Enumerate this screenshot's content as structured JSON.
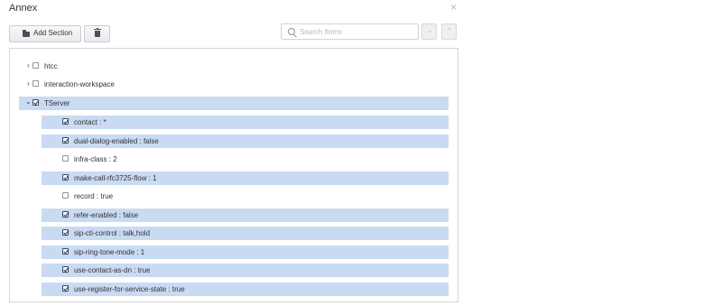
{
  "dialog": {
    "title": "Annex",
    "close_glyph": "×"
  },
  "toolbar": {
    "add_section_label": "Add Section",
    "add_icon": "folder-icon",
    "delete_icon": "trash-icon"
  },
  "search": {
    "placeholder": "Search Items",
    "value": "",
    "icon": "search-icon",
    "prev_glyph": "⌄",
    "next_glyph": "⌃"
  },
  "colors": {
    "selected_row": "#c9daf3",
    "panel_border": "#d4d7da"
  },
  "tree": {
    "sections": [
      {
        "label": "htcc",
        "checked": false,
        "expanded": false,
        "chevron": "›"
      },
      {
        "label": "interaction-workspace",
        "checked": false,
        "expanded": false,
        "chevron": "›"
      },
      {
        "label": "TServer",
        "checked": true,
        "expanded": true,
        "chevron": "⌄"
      }
    ],
    "items": [
      {
        "label": "contact : *",
        "checked": true
      },
      {
        "label": "dual-dialog-enabled : false",
        "checked": true
      },
      {
        "label": "infra-class : 2",
        "checked": false
      },
      {
        "label": "make-call-rfc3725-flow : 1",
        "checked": true
      },
      {
        "label": "record : true",
        "checked": false
      },
      {
        "label": "refer-enabled : false",
        "checked": true
      },
      {
        "label": "sip-cti-control : talk,hold",
        "checked": true
      },
      {
        "label": "sip-ring-tone-mode : 1",
        "checked": true
      },
      {
        "label": "use-contact-as-dn : true",
        "checked": true
      },
      {
        "label": "use-register-for-service-state : true",
        "checked": true
      }
    ]
  }
}
